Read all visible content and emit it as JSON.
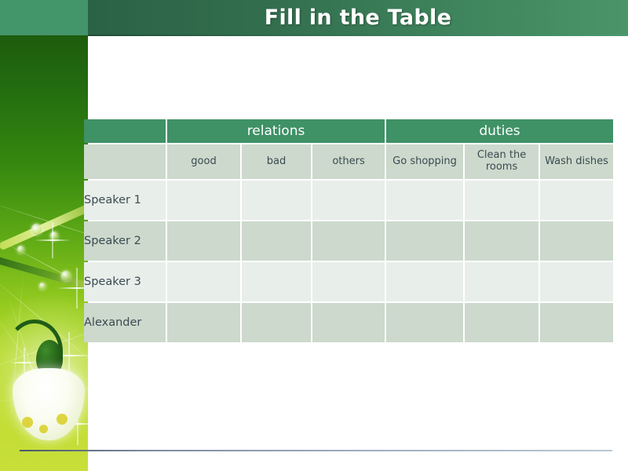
{
  "slide": {
    "title": "Fill in the Table",
    "background_color": "#ffffff",
    "header_color_left": "#2a6245",
    "header_color_right": "#4b9469",
    "corner_block_color": "#43956a",
    "accent_color": "#3f9166"
  },
  "decor": {
    "side_image_name": "snowdrop-flower-green-gradient",
    "bottom_rule_color": "#7c8c9c"
  },
  "table": {
    "group_headers": [
      {
        "label": "",
        "span": 1
      },
      {
        "label": "relations",
        "span": 3
      },
      {
        "label": "duties",
        "span": 3
      }
    ],
    "column_headers": [
      "",
      "good",
      "bad",
      "others",
      "Go shopping",
      "Clean the rooms",
      "Wash dishes"
    ],
    "rows": [
      {
        "label": "Speaker 1",
        "cells": [
          "",
          "",
          "",
          "",
          "",
          ""
        ]
      },
      {
        "label": "Speaker 2",
        "cells": [
          "",
          "",
          "",
          "",
          "",
          ""
        ]
      },
      {
        "label": "Speaker 3",
        "cells": [
          "",
          "",
          "",
          "",
          "",
          ""
        ]
      },
      {
        "label": "Alexander",
        "cells": [
          "",
          "",
          "",
          "",
          "",
          ""
        ]
      }
    ],
    "header_bg": "#3f9166",
    "subheader_bg": "#ccd9cc",
    "row_light_bg": "#e8eeea",
    "row_dark_bg": "#ccd9cc",
    "text_color": "#3b4a52"
  }
}
